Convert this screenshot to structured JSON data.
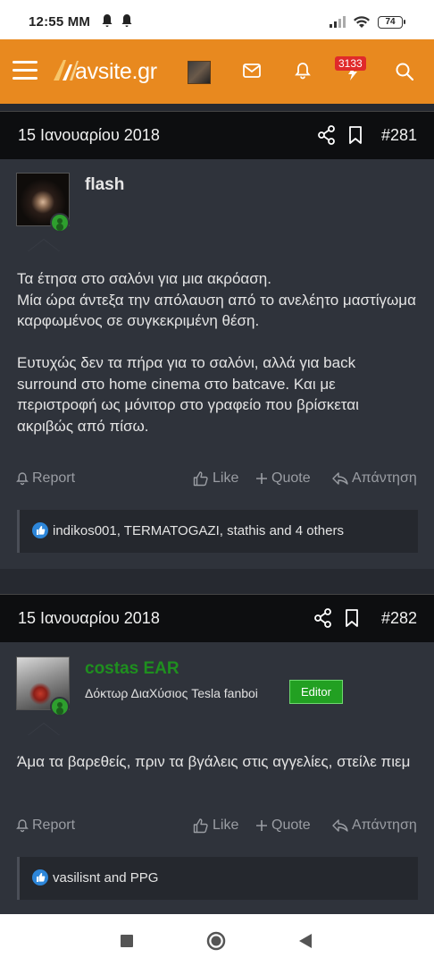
{
  "status_bar": {
    "time": "12:55 MM",
    "battery": "74"
  },
  "navbar": {
    "logo_text": "avsite.gr",
    "alerts_badge": "3133",
    "icons": [
      "menu-icon",
      "logo-icon",
      "user-avatar",
      "mail-icon",
      "bell-icon",
      "lightning-icon",
      "search-icon"
    ]
  },
  "posts": [
    {
      "date": "15 Ιανουαρίου 2018",
      "number": "#281",
      "username": "flash",
      "user_title": "",
      "paragraphs": [
        "Τα έτησα στο σαλόνι για μια ακρόαση.\nΜία ώρα άντεξα την απόλαυση από το ανελέητο μαστίγωμα καρφωμένος σε συγκεκριμένη θέση.",
        "Ευτυχώς δεν τα πήρα για το σαλόνι, αλλά για back surround στο home cinema στο batcave. Και με περιστροφή ως μόνιτορ στο γραφείο που βρίσκεται ακριβώς από πίσω."
      ],
      "actions": {
        "report": "Report",
        "like": "Like",
        "quote": "Quote",
        "reply": "Απάντηση"
      },
      "reactions": "indikos001, TERMATOGAZI, stathis and 4 others"
    },
    {
      "date": "15 Ιανουαρίου 2018",
      "number": "#282",
      "username": "costas EAR",
      "user_title": "Δόκτωρ ΔιαΧύσιος Tesla fanboi",
      "badge": "Editor",
      "paragraphs": [
        "Άμα τα βαρεθείς, πριν τα βγάλεις στις αγγελίες, στείλε πιεμ"
      ],
      "actions": {
        "report": "Report",
        "like": "Like",
        "quote": "Quote",
        "reply": "Απάντηση"
      },
      "reactions": "vasilisnt and PPG"
    }
  ],
  "colors": {
    "nav_orange": "#e8891f",
    "post_bg": "#2f333b",
    "header_bg": "#0d0e10",
    "editor_green": "#22a022",
    "costas_name_green": "#1f8f1f",
    "like_blue": "#2d86d9"
  }
}
